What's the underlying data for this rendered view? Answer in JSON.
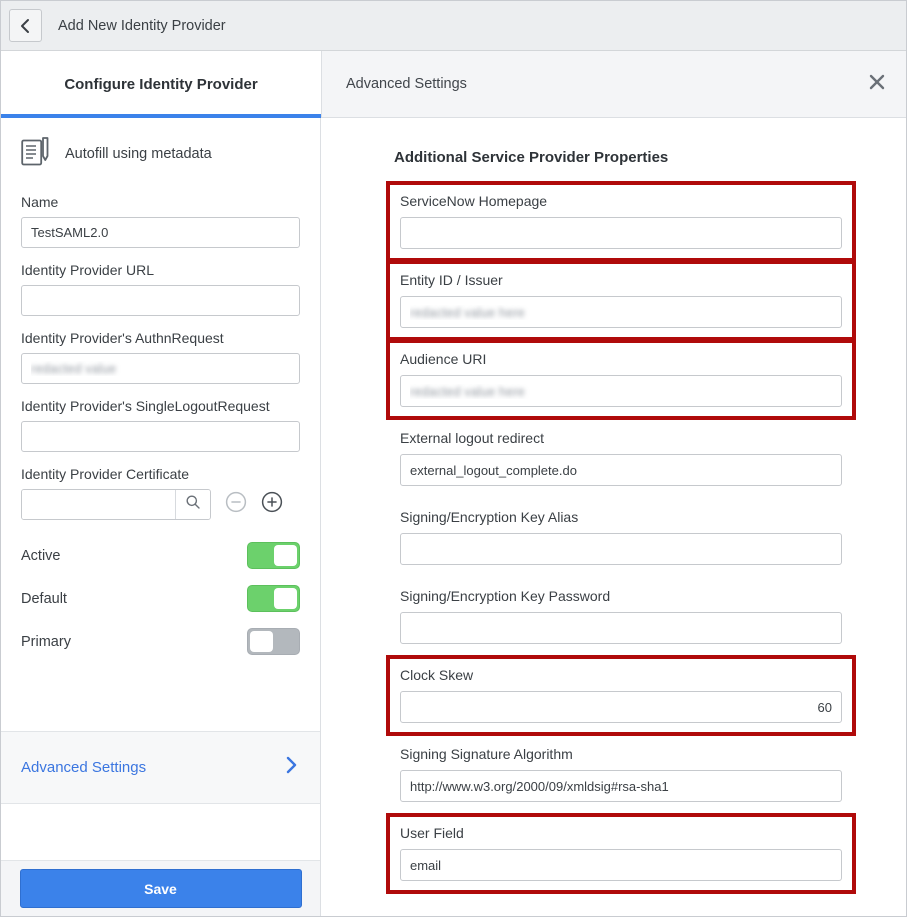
{
  "topbar": {
    "back_icon": "chevron-left-icon",
    "title": "Add New Identity Provider"
  },
  "tabs": {
    "left_label": "Configure Identity Provider",
    "right_label": "Advanced Settings",
    "close_icon": "close-icon",
    "accent_color": "#3b82ea"
  },
  "sidebar": {
    "autofill": {
      "icon": "document-pen-icon",
      "label": "Autofill using metadata"
    },
    "fields": [
      {
        "label": "Name",
        "value": "TestSAML2.0",
        "redacted": false
      },
      {
        "label": "Identity Provider URL",
        "value": "",
        "redacted": false
      },
      {
        "label": "Identity Provider's AuthnRequest",
        "value": "redacted value",
        "redacted": true
      },
      {
        "label": "Identity Provider's SingleLogoutRequest",
        "value": "",
        "redacted": false
      }
    ],
    "certificate": {
      "label": "Identity Provider Certificate",
      "value": "",
      "search_icon": "search-icon",
      "remove_icon": "minus-circle-icon",
      "add_icon": "plus-circle-icon"
    },
    "toggles": [
      {
        "label": "Active",
        "state": "on"
      },
      {
        "label": "Default",
        "state": "on"
      },
      {
        "label": "Primary",
        "state": "off"
      }
    ],
    "advanced_settings": {
      "label": "Advanced Settings",
      "chevron_icon": "chevron-right-icon"
    },
    "save_label": "Save"
  },
  "panel": {
    "title": "Additional Service Provider Properties",
    "highlight_color": "#b00a0a",
    "fields": [
      {
        "label": "ServiceNow Homepage",
        "value": "",
        "redacted": false,
        "highlighted": true,
        "align": "left"
      },
      {
        "label": "Entity ID / Issuer",
        "value": "redacted value here",
        "redacted": true,
        "highlighted": true,
        "align": "left"
      },
      {
        "label": "Audience URI",
        "value": "redacted value here",
        "redacted": true,
        "highlighted": true,
        "align": "left"
      },
      {
        "label": "External logout redirect",
        "value": "external_logout_complete.do",
        "redacted": false,
        "highlighted": false,
        "align": "left"
      },
      {
        "label": "Signing/Encryption Key Alias",
        "value": "",
        "redacted": false,
        "highlighted": false,
        "align": "left"
      },
      {
        "label": "Signing/Encryption Key Password",
        "value": "",
        "redacted": false,
        "highlighted": false,
        "align": "left"
      },
      {
        "label": "Clock Skew",
        "value": "60",
        "redacted": false,
        "highlighted": true,
        "align": "right"
      },
      {
        "label": "Signing Signature Algorithm",
        "value": "http://www.w3.org/2000/09/xmldsig#rsa-sha1",
        "redacted": false,
        "highlighted": false,
        "align": "left"
      },
      {
        "label": "User Field",
        "value": "email",
        "redacted": false,
        "highlighted": true,
        "align": "left"
      }
    ]
  }
}
